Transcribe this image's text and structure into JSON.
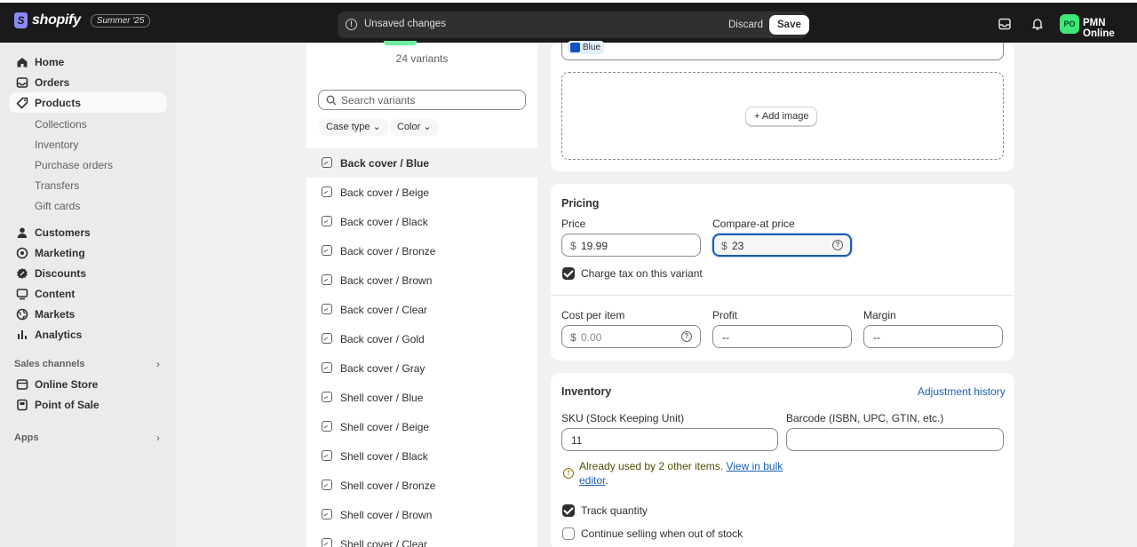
{
  "topbar": {
    "brand": "shopify",
    "edition": "Summer '25",
    "unsaved_message": "Unsaved changes",
    "discard_label": "Discard",
    "save_label": "Save",
    "avatar_initials": "PO",
    "store_name": "PMN Online"
  },
  "sidebar": {
    "items": [
      {
        "label": "Home",
        "icon": "home-icon"
      },
      {
        "label": "Orders",
        "icon": "inbox-icon"
      },
      {
        "label": "Products",
        "icon": "tag-icon",
        "active": true
      },
      {
        "label": "Customers",
        "icon": "person-icon"
      },
      {
        "label": "Marketing",
        "icon": "target-icon"
      },
      {
        "label": "Discounts",
        "icon": "discount-icon"
      },
      {
        "label": "Content",
        "icon": "content-icon"
      },
      {
        "label": "Markets",
        "icon": "globe-icon"
      },
      {
        "label": "Analytics",
        "icon": "bar-chart-icon"
      }
    ],
    "product_subitems": [
      "Collections",
      "Inventory",
      "Purchase orders",
      "Transfers",
      "Gift cards"
    ],
    "sales_channels_label": "Sales channels",
    "channels": [
      {
        "label": "Online Store",
        "icon": "store-icon"
      },
      {
        "label": "Point of Sale",
        "icon": "pos-icon"
      }
    ],
    "apps_label": "Apps"
  },
  "variants_panel": {
    "count_text": "24 variants",
    "search_placeholder": "Search variants",
    "filters": [
      "Case type",
      "Color"
    ],
    "variants": [
      "Back cover / Blue",
      "Back cover / Beige",
      "Back cover / Black",
      "Back cover / Bronze",
      "Back cover / Brown",
      "Back cover / Clear",
      "Back cover / Gold",
      "Back cover / Gray",
      "Shell cover / Blue",
      "Shell cover / Beige",
      "Shell cover / Black",
      "Shell cover / Bronze",
      "Shell cover / Brown",
      "Shell cover / Clear"
    ],
    "selected_variant": "Back cover / Blue"
  },
  "media": {
    "option_chip": "Blue",
    "option_color": "#1451c4",
    "add_image_label": "Add image"
  },
  "pricing": {
    "title": "Pricing",
    "price_label": "Price",
    "price_currency": "$",
    "price_value": "19.99",
    "compare_label": "Compare-at price",
    "compare_currency": "$",
    "compare_value": "23",
    "charge_tax_label": "Charge tax on this variant",
    "charge_tax_checked": true,
    "cost_label": "Cost per item",
    "cost_currency": "$",
    "cost_placeholder": "0.00",
    "profit_label": "Profit",
    "profit_value": "--",
    "margin_label": "Margin",
    "margin_value": "--"
  },
  "inventory": {
    "title": "Inventory",
    "adjustment_link": "Adjustment history",
    "sku_label": "SKU (Stock Keeping Unit)",
    "sku_value": "11",
    "barcode_label": "Barcode (ISBN, UPC, GTIN, etc.)",
    "barcode_value": "",
    "warning_text": "Already used by 2 other items.",
    "warning_link": "View in bulk editor",
    "track_quantity_label": "Track quantity",
    "track_quantity_checked": true,
    "continue_selling_label": "Continue selling when out of stock",
    "continue_selling_checked": false
  },
  "colors": {
    "topbar_bg": "#1a1a1a",
    "accent_link": "#1a5fb4",
    "avatar_bg": "#3de878",
    "focus_border": "#1d5cb0"
  }
}
